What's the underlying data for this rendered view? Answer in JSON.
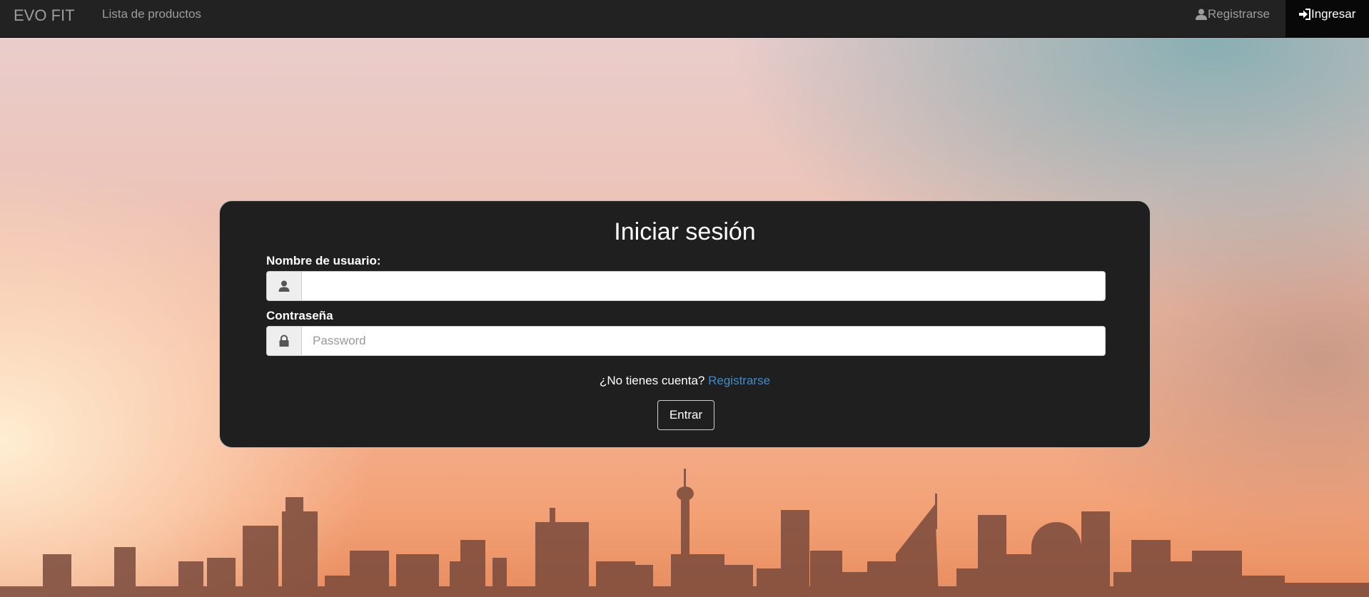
{
  "navbar": {
    "brand": "EVO FIT",
    "products_link": "Lista de productos",
    "register_link": "Registrarse",
    "login_link": "Ingresar"
  },
  "login": {
    "title": "Iniciar sesión",
    "username_label": "Nombre de usuario:",
    "username_value": "",
    "password_label": "Contraseña",
    "password_placeholder": "Password",
    "no_account_text": "¿No tienes cuenta? ",
    "register_link": "Registrarse",
    "submit_label": "Entrar"
  },
  "icons": {
    "register": "user-icon",
    "login": "log-in-icon",
    "username": "user-icon",
    "password": "lock-icon"
  },
  "colors": {
    "navbar_bg": "#222222",
    "panel_bg": "#1f1f1f",
    "link": "#428bca"
  }
}
